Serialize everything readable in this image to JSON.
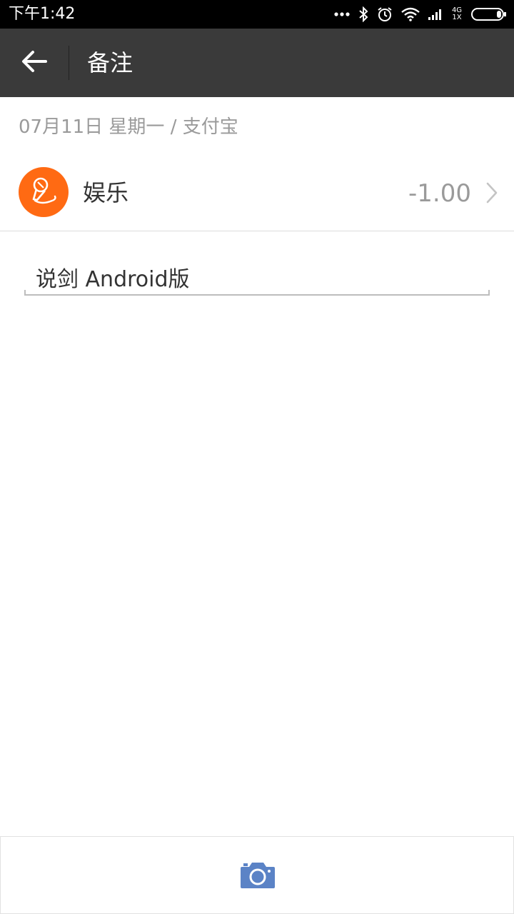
{
  "status_bar": {
    "time": "下午1:42",
    "icons": [
      "more-dots-icon",
      "bluetooth-icon",
      "alarm-icon",
      "wifi-icon",
      "signal-icon",
      "battery-icon"
    ],
    "network_top": "4G",
    "network_bottom": "1X"
  },
  "header": {
    "back_icon": "arrow-left-icon",
    "title": "备注"
  },
  "record": {
    "date_line": "07月11日 星期一 / 支付宝",
    "category": {
      "name": "娱乐",
      "icon": "microphone-icon",
      "color": "#ff6a13"
    },
    "amount": "-1.00"
  },
  "note": {
    "value": "说剑 Android版"
  },
  "bottom_bar": {
    "camera_icon": "camera-icon",
    "camera_color": "#5b83c6"
  },
  "colors": {
    "header_bg": "#3a3a3a",
    "accent_orange": "#ff6a13",
    "secondary_text": "#9a9a9a"
  }
}
